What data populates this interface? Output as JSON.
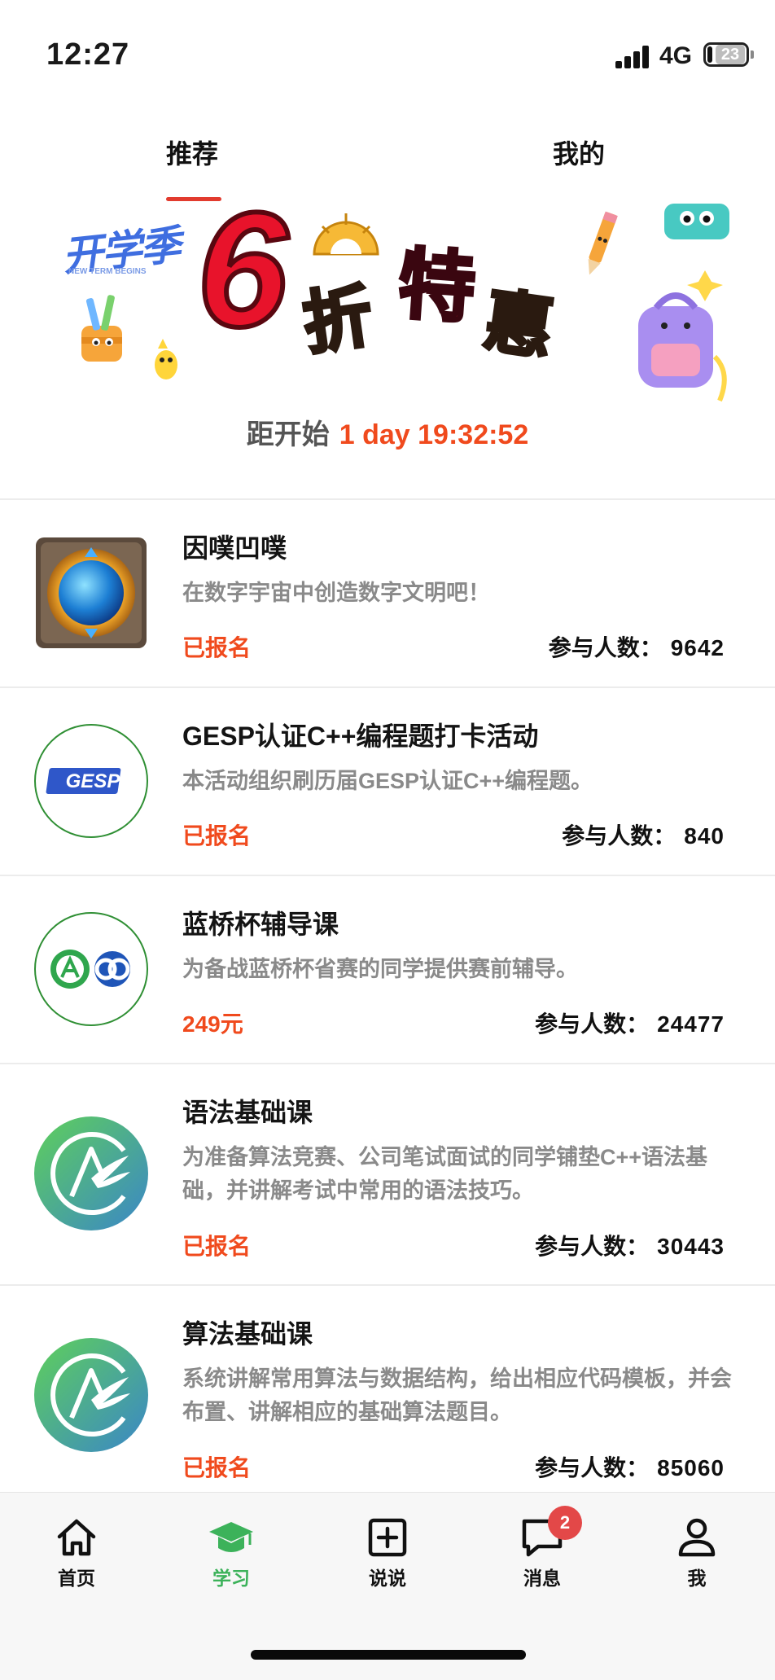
{
  "status_bar": {
    "time": "12:27",
    "network": "4G",
    "battery": "23"
  },
  "tabs": [
    {
      "label": "推荐",
      "active": true
    },
    {
      "label": "我的",
      "active": false
    }
  ],
  "banner": {
    "badge_text": "开学季",
    "badge_sub": "NEW TERM BEGINS",
    "big_number": "6",
    "chars": [
      "折",
      "特",
      "惠"
    ],
    "countdown_label": "距开始",
    "countdown_value": "1 day 19:32:52"
  },
  "courses": [
    {
      "title": "因噗凹噗",
      "desc": "在数字宇宙中创造数字文明吧！",
      "status": "已报名",
      "count_label": "参与人数：",
      "count": "9642",
      "logo": "blue-gem-emblem"
    },
    {
      "title": "GESP认证C++编程题打卡活动",
      "desc": "本活动组织刷历届GESP认证C++编程题。",
      "status": "已报名",
      "count_label": "参与人数：",
      "count": "840",
      "logo": "gesp-logo",
      "logo_text": "GESP"
    },
    {
      "title": "蓝桥杯辅导课",
      "desc": "为备战蓝桥杯省赛的同学提供赛前辅导。",
      "status": "249元",
      "count_label": "参与人数：",
      "count": "24477",
      "logo": "lanqiao-logo"
    },
    {
      "title": "语法基础课",
      "desc": "为准备算法竞赛、公司笔试面试的同学铺垫C++语法基础，并讲解考试中常用的语法技巧。",
      "status": "已报名",
      "count_label": "参与人数：",
      "count": "30443",
      "logo": "acwing-logo"
    },
    {
      "title": "算法基础课",
      "desc": "系统讲解常用算法与数据结构，给出相应代码模板，并会布置、讲解相应的基础算法题目。",
      "status": "已报名",
      "count_label": "参与人数：",
      "count": "85060",
      "logo": "acwing-logo"
    }
  ],
  "bottom_nav": [
    {
      "label": "首页",
      "icon": "home-icon",
      "active": false
    },
    {
      "label": "学习",
      "icon": "graduation-cap-icon",
      "active": true
    },
    {
      "label": "说说",
      "icon": "plus-square-icon",
      "active": false
    },
    {
      "label": "消息",
      "icon": "chat-bubble-icon",
      "active": false,
      "badge": "2"
    },
    {
      "label": "我",
      "icon": "user-icon",
      "active": false
    }
  ],
  "colors": {
    "accent_red": "#f04a1d",
    "tab_underline": "#e23b2e",
    "active_green": "#3cb25a",
    "badge_red": "#e34848"
  }
}
